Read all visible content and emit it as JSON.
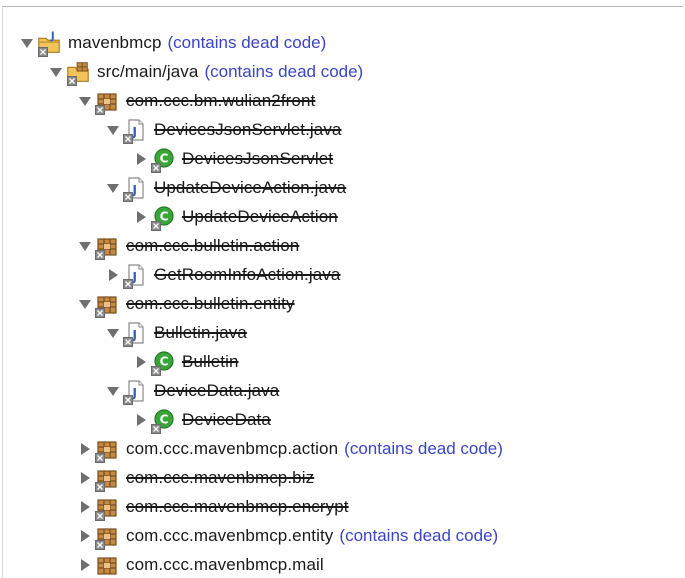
{
  "tree": {
    "root": {
      "label": "mavenbmcp",
      "note": "(contains dead code)"
    },
    "src": {
      "label": "src/main/java",
      "note": "(contains dead code)"
    },
    "pkg_wulian": {
      "label": "com.ccc.bm.wulian2front"
    },
    "file_devices_json": {
      "label": "DevicesJsonServlet.java"
    },
    "class_devices_json": {
      "label": "DevicesJsonServlet"
    },
    "file_update_action": {
      "label": "UpdateDeviceAction.java"
    },
    "class_update_action": {
      "label": "UpdateDeviceAction"
    },
    "pkg_bulletin_action": {
      "label": "com.ccc.bulletin.action"
    },
    "file_getroom": {
      "label": "GetRoomInfoAction.java"
    },
    "pkg_bulletin_entity": {
      "label": "com.ccc.bulletin.entity"
    },
    "file_bulletin": {
      "label": "Bulletin.java"
    },
    "class_bulletin": {
      "label": "Bulletin"
    },
    "file_devicedata": {
      "label": "DeviceData.java"
    },
    "class_devicedata": {
      "label": "DeviceData"
    },
    "pkg_mav_action": {
      "label": "com.ccc.mavenbmcp.action",
      "note": "(contains dead code)"
    },
    "pkg_mav_biz": {
      "label": "com.ccc.mavenbmcp.biz"
    },
    "pkg_mav_encrypt": {
      "label": "com.ccc.mavenbmcp.encrypt"
    },
    "pkg_mav_entity": {
      "label": "com.ccc.mavenbmcp.entity",
      "note": "(contains dead code)"
    },
    "pkg_mav_mail": {
      "label": "com.ccc.mavenbmcp.mail"
    }
  },
  "icons": {
    "project": "java-project-icon",
    "source_folder": "source-folder-icon",
    "package": "package-icon",
    "java_file": "java-file-icon",
    "class": "class-icon",
    "expanded": "chevron-down-icon",
    "collapsed": "chevron-right-icon"
  },
  "colors": {
    "note": "#3a45c6",
    "text": "#1a1a1a",
    "package_brown": "#9b6a2f",
    "class_green": "#3aa63a",
    "java_blue": "#2f5fb8"
  }
}
